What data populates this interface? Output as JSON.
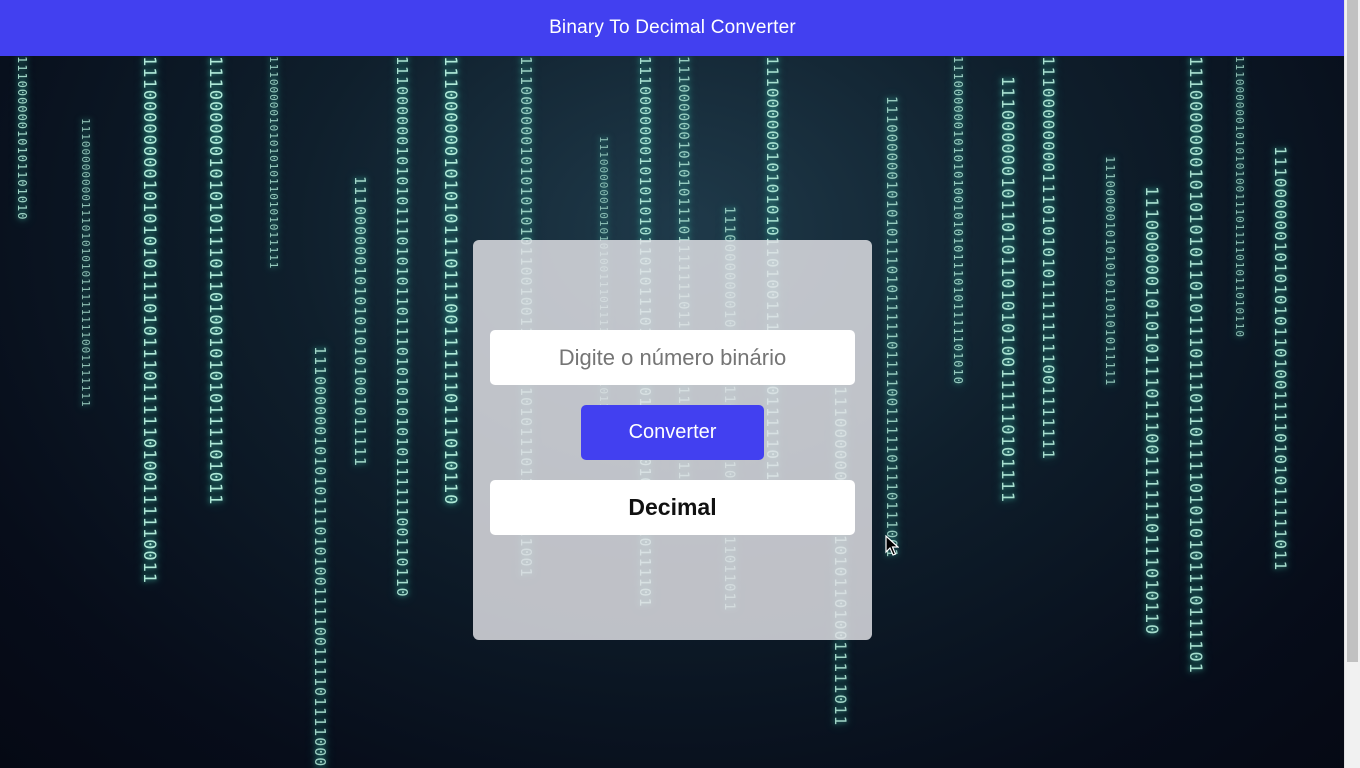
{
  "header": {
    "title": "Binary To Decimal Converter"
  },
  "converter": {
    "input_placeholder": "Digite o número binário",
    "input_value": "",
    "button_label": "Converter",
    "result_label": "Decimal"
  },
  "colors": {
    "accent": "#4240f0",
    "rain": "#b9f5e2"
  },
  "background": {
    "binary_streams": [
      "11100000010101101010",
      "11100000000111010101011111111001111111",
      "11100000000101010101110101110111110100111110011",
      "1110000001010101110110100101010111101011",
      "1110000010101010110101011111",
      "111000000101010111010100111100111101111000111",
      "11100000010101010101001011111",
      "111000000101010111010101101110101010101011111100110110",
      "1110000001010101110111001111110111010110",
      "1110000001010101010110010011111111010111011010111001",
      "1110000001010101001110111101011010110",
      "1110000000101010101101011101110110111101010101110111101",
      "1110000001010101110111111101110011011111111111",
      "1110000000010101010110111111011011111011011",
      "1110000001010101011010011110101011111011",
      "11100000001010101011010011111011",
      "1110000001010101110101111101111001111101110111001",
      "1110000001010101001010101110101111101010",
      "11100000010110101101010100111110101111"
    ]
  }
}
